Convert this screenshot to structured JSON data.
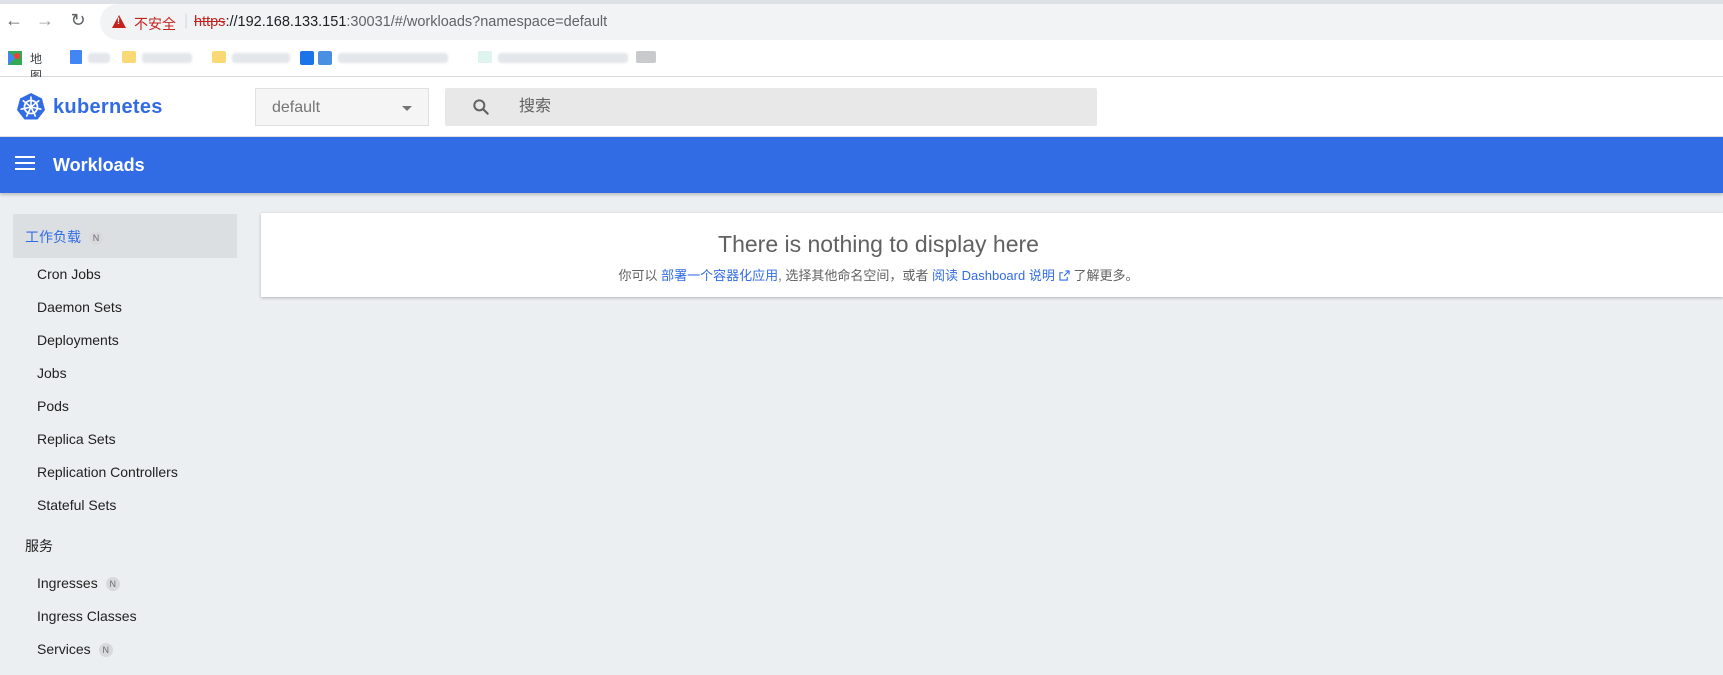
{
  "browser": {
    "insecure_label": "不安全",
    "url_scheme": "https",
    "url_host": "://192.168.133.151",
    "url_rest": ":30031/#/workloads?namespace=default",
    "bookmark_first": "地图"
  },
  "header": {
    "brand": "kubernetes",
    "namespace": "default",
    "search_placeholder": "搜索"
  },
  "toolbar": {
    "title": "Workloads"
  },
  "sidebar": {
    "category": {
      "label": "工作负载",
      "badge": "N"
    },
    "workload_items": [
      "Cron Jobs",
      "Daemon Sets",
      "Deployments",
      "Jobs",
      "Pods",
      "Replica Sets",
      "Replication Controllers",
      "Stateful Sets"
    ],
    "services_section": "服务",
    "service_items": [
      {
        "label": "Ingresses",
        "badge": "N"
      },
      {
        "label": "Ingress Classes"
      },
      {
        "label": "Services",
        "badge": "N"
      }
    ]
  },
  "main": {
    "empty_title": "There is nothing to display here",
    "empty_prefix": "你可以 ",
    "deploy_link": "部署一个容器化应用",
    "empty_middle": ", 选择其他命名空间，或者 ",
    "docs_link": "阅读 Dashboard 说明",
    "empty_suffix": " 了解更多。"
  },
  "colors": {
    "primary": "#326ce5",
    "insecure": "#c5221f"
  }
}
